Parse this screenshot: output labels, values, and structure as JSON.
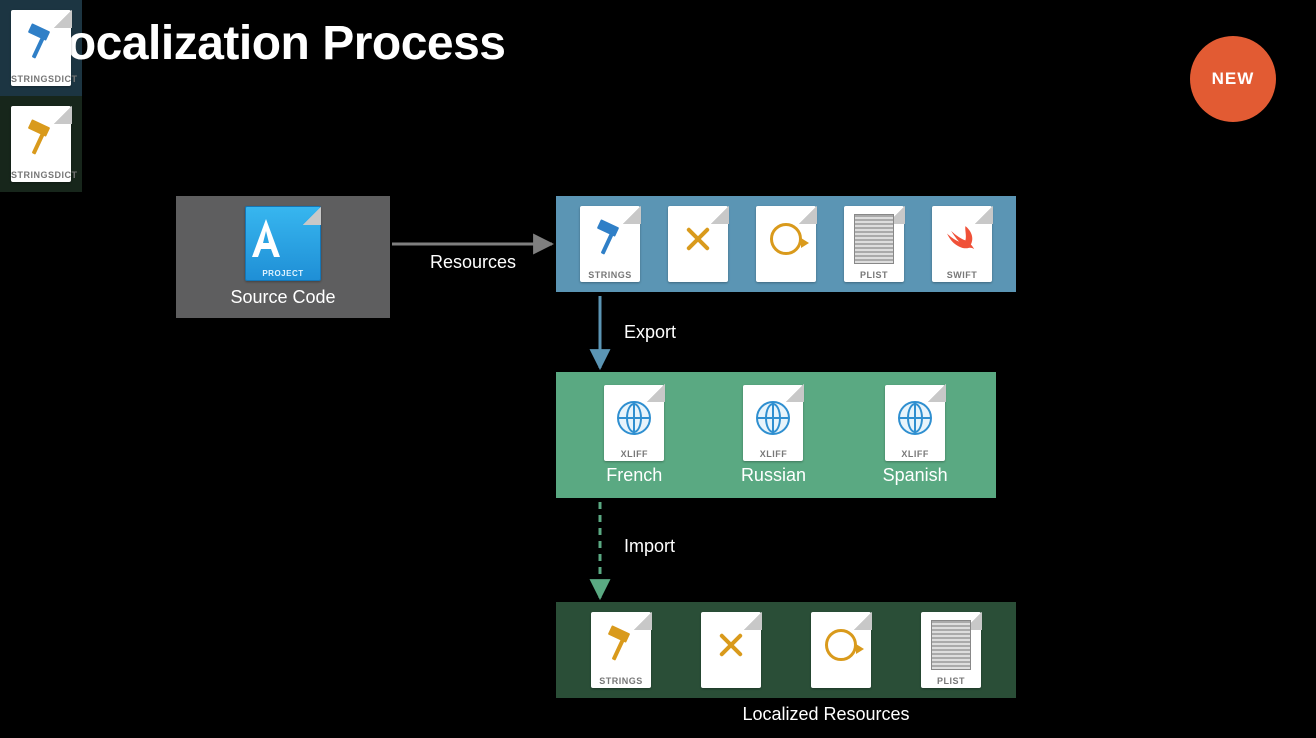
{
  "title": "Localization Process",
  "badge": "NEW",
  "source": {
    "caption": "Source Code",
    "icon_label": "PROJECT"
  },
  "arrows": {
    "resources": "Resources",
    "export": "Export",
    "import": "Import"
  },
  "resource_files": [
    {
      "label": "STRINGS",
      "icon": "hammer"
    },
    {
      "label": "",
      "icon": "xmark"
    },
    {
      "label": "",
      "icon": "swirl"
    },
    {
      "label": "PLIST",
      "icon": "plist"
    },
    {
      "label": "SWIFT",
      "icon": "swift"
    }
  ],
  "stringsdict": {
    "label": "STRINGSDICT",
    "icon": "hammer"
  },
  "languages": [
    {
      "file_label": "XLIFF",
      "name": "French"
    },
    {
      "file_label": "XLIFF",
      "name": "Russian"
    },
    {
      "file_label": "XLIFF",
      "name": "Spanish"
    }
  ],
  "localized_files": [
    {
      "label": "STRINGS",
      "icon": "hammer-amber"
    },
    {
      "label": "",
      "icon": "xmark"
    },
    {
      "label": "",
      "icon": "swirl"
    },
    {
      "label": "PLIST",
      "icon": "plist"
    }
  ],
  "localized_stringsdict": {
    "label": "STRINGSDICT",
    "icon": "hammer-amber"
  },
  "localized_caption": "Localized Resources"
}
